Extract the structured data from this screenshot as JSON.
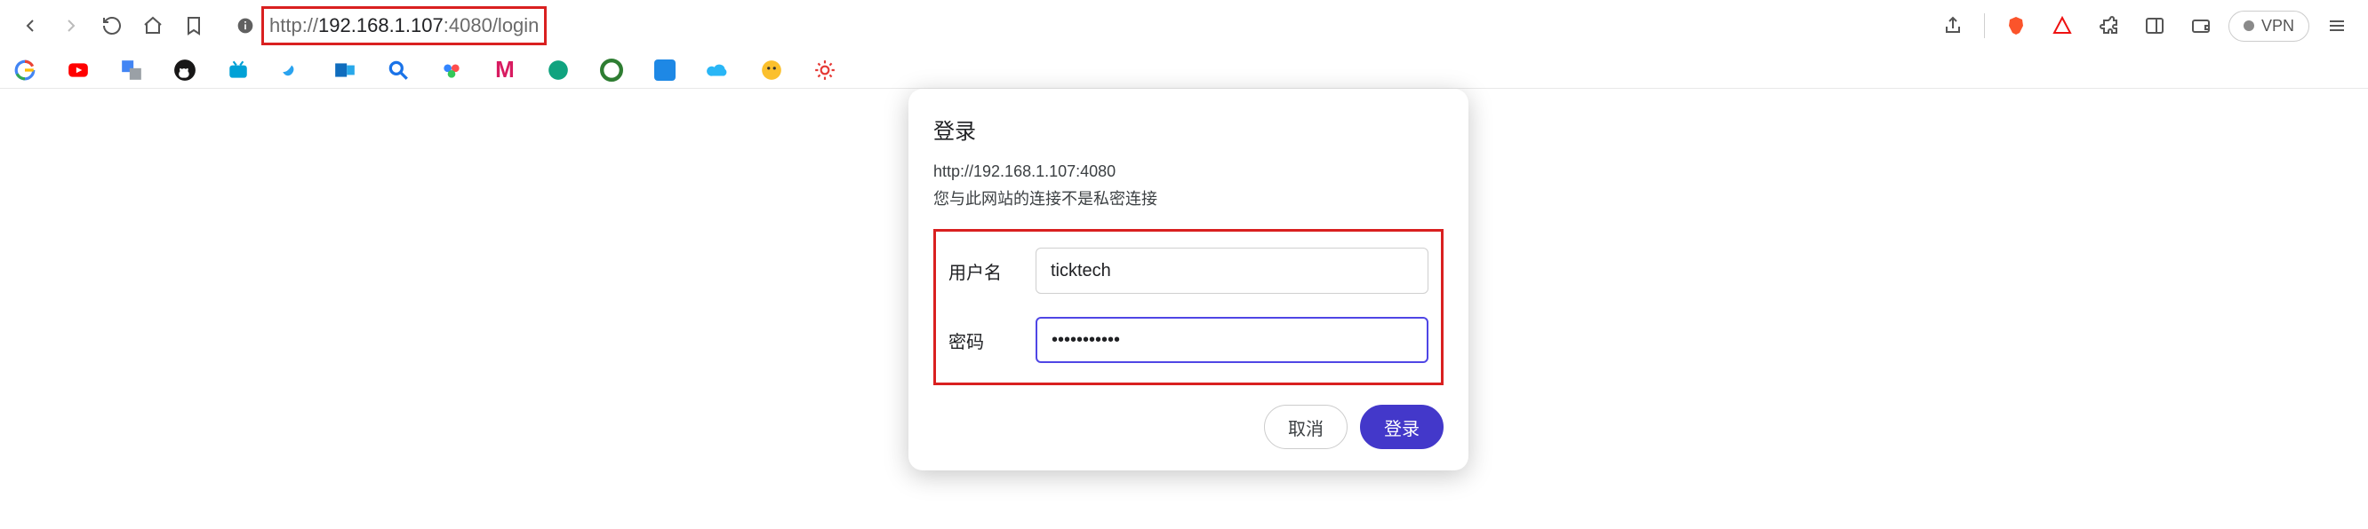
{
  "toolbar": {
    "url_scheme": "http://",
    "url_host": "192.168.1.107",
    "url_port": ":4080",
    "url_path": "/login",
    "vpn_label": "VPN"
  },
  "bookmarks": {
    "items": [
      {
        "name": "google"
      },
      {
        "name": "youtube"
      },
      {
        "name": "translate"
      },
      {
        "name": "github"
      },
      {
        "name": "bilibili"
      },
      {
        "name": "dove"
      },
      {
        "name": "outlook"
      },
      {
        "name": "search"
      },
      {
        "name": "baidu-app"
      },
      {
        "name": "m-bookmark"
      },
      {
        "name": "chatgpt"
      },
      {
        "name": "wechat-like"
      },
      {
        "name": "blue-app"
      },
      {
        "name": "cloud"
      },
      {
        "name": "yellow-circle"
      },
      {
        "name": "red-gear"
      }
    ]
  },
  "auth_dialog": {
    "title": "登录",
    "url": "http://192.168.1.107:4080",
    "warning": "您与此网站的连接不是私密连接",
    "username_label": "用户名",
    "username_value": "ticktech",
    "password_label": "密码",
    "password_value": "•••••••••••",
    "cancel_label": "取消",
    "submit_label": "登录"
  }
}
